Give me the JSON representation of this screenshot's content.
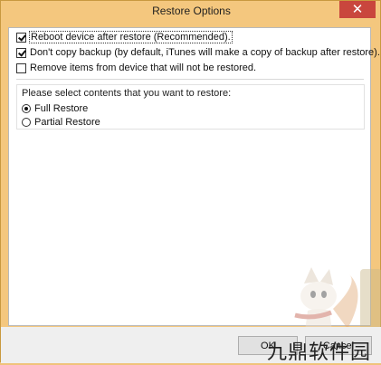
{
  "window": {
    "title": "Restore Options",
    "close_glyph": "✕"
  },
  "options": {
    "reboot": {
      "label": "Reboot device after restore (Recommended).",
      "checked": true
    },
    "no_backup": {
      "label": "Don't copy backup (by default, iTunes will make a copy of backup after restore).",
      "checked": true
    },
    "remove_items": {
      "label": "Remove items from device that will not be restored.",
      "checked": false
    }
  },
  "restore_contents": {
    "prompt": "Please select contents that you want to restore:",
    "full_restore": {
      "label": "Full Restore",
      "selected": true
    },
    "partial_restore": {
      "label": "Partial Restore",
      "selected": false
    }
  },
  "footer": {
    "ok_label": "OK",
    "cancel_label": "Cancel"
  },
  "watermark": {
    "text": "九鼎软件园",
    "logo_icon": "fox-mascot-icon"
  },
  "colors": {
    "titlebar": "#f4c77e",
    "close_button": "#c9463d",
    "client": "#ffffff"
  }
}
